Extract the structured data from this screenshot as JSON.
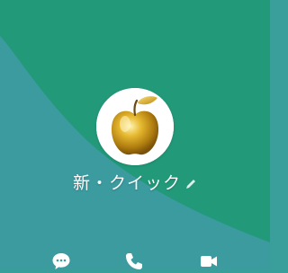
{
  "profile": {
    "name": "新・クイック",
    "avatar": "golden-apple-image"
  },
  "colors": {
    "bg_dark_green": "#229a7a",
    "bg_teal": "#3a9e9a",
    "text": "#ffffff"
  },
  "icons": {
    "edit": "pencil-icon",
    "chat": "chat-bubble-icon",
    "call": "phone-icon",
    "video": "video-camera-icon"
  }
}
